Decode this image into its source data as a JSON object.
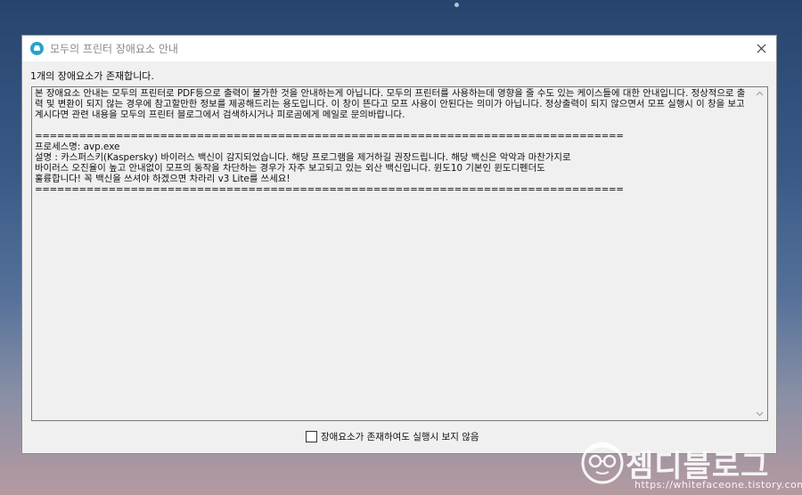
{
  "window": {
    "title": "모두의 프린터 장애요소 안내",
    "error_count": "1개의 장애요소가 존재합니다.",
    "message_lines": [
      "본 장애요소 안내는 모두의 프린터로 PDF등으로 출력이 불가한 것을 안내하는게 아닙니다. 모두의 프린터를 사용하는데 영향을 줄 수도 있는 케이스들에 대한 안내입니다. 정상적으로 출력 및 변환이 되지 않는 경우에 참고할만한 정보를 제공해드리는 용도입니다. 이 창이 뜬다고 모프 사용이 안된다는 의미가 아닙니다. 정상출력이 되지 않으면서 모프 실행시 이 창을 보고 계시다면 관련 내용을 모두의 프린터 블로그에서 검색하시거나 피로곰에게 메일로 문의바랍니다.",
      "",
      "================================================================================",
      "프로세스명: avp.exe",
      "설명 : 카스퍼스키(Kaspersky) 바이러스 백신이 감지되었습니다. 해당 프로그램을 제거하길 권장드립니다. 해당 백신은 악악과 마찬가지로",
      "바이러스 오진율이 높고 안내없이 모프의 동작을 차단하는 경우가 자주 보고되고 있는 외산 백신입니다. 윈도10 기본인 윈도디펜더도",
      "훌륭합니다! 꼭 백신을 쓰셔야 하겠으면 차라리 v3 Lite를 쓰세요!",
      "================================================================================"
    ],
    "dont_show_label": "장애요소가 존재하여도 실행시 보지 않음",
    "dont_show_checked": false
  },
  "watermark": {
    "logo_text": "젬디블로그",
    "url": "https://whitefaceone.tistory.com"
  },
  "colors": {
    "icon_accent": "#2aa3c9",
    "dialog_bg": "#f0f0f0"
  }
}
